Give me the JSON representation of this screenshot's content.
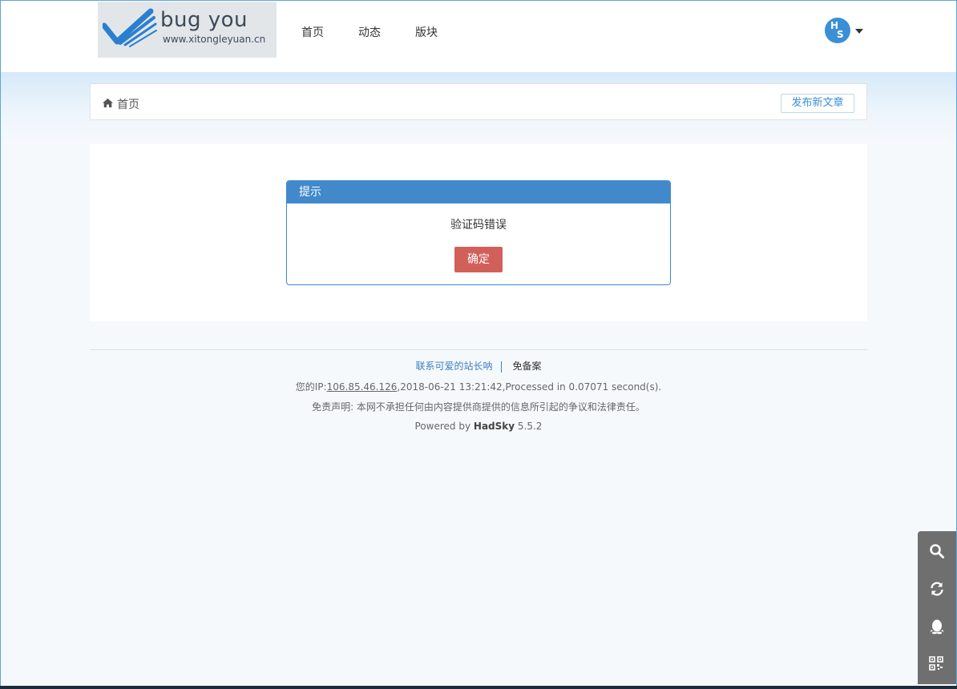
{
  "logo": {
    "title": "bug you",
    "subtitle": "www.xitongleyuan.cn"
  },
  "nav": {
    "items": [
      {
        "label": "首页"
      },
      {
        "label": "动态"
      },
      {
        "label": "版块"
      }
    ]
  },
  "user": {
    "avatar_initial_1": "H",
    "avatar_initial_2": "S",
    "menu_icon": "caret-down-icon"
  },
  "breadcrumb": {
    "icon": "home-icon",
    "label": "首页",
    "post_button": "发布新文章"
  },
  "dialog": {
    "title": "提示",
    "message": "验证码错误",
    "ok_button": "确定"
  },
  "footer": {
    "contact_link": "联系可爱的站长呐",
    "beian": "免备案",
    "ip_prefix": "您的IP:",
    "ip": "106.85.46.126",
    "ip_suffix": ",2018-06-21 13:21:42,Processed in 0.07071 second(s).",
    "disclaimer": "免责声明: 本网不承担任何由内容提供商提供的信息所引起的争议和法律责任。",
    "powered_prefix": "Powered by ",
    "powered_brand": "HadSky",
    "powered_version": " 5.5.2"
  },
  "toolbar": {
    "items": [
      "search-icon",
      "refresh-icon",
      "qq-icon",
      "qrcode-icon"
    ]
  },
  "colors": {
    "accent": "#4289cc",
    "ok_button": "#d2605a",
    "toolbar": "#6f6f6f"
  }
}
